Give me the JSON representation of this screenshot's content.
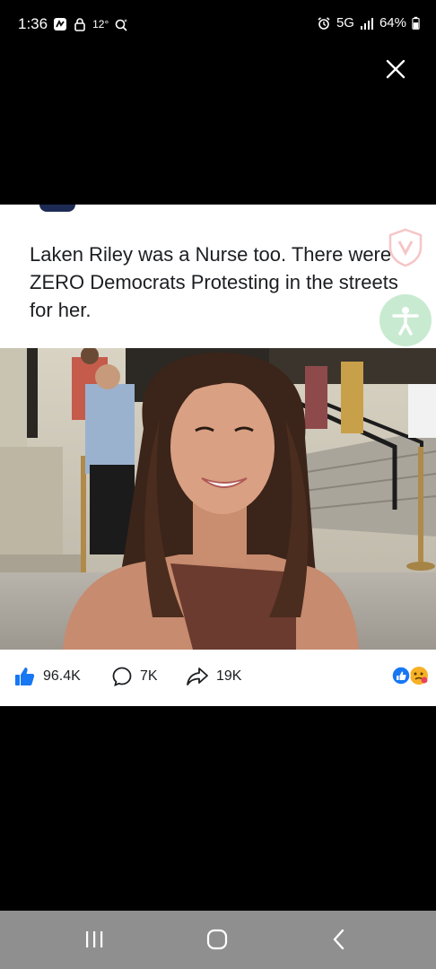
{
  "status_bar": {
    "time": "1:36",
    "temperature": "12°",
    "network": "5G",
    "battery": "64%"
  },
  "post": {
    "text": "Laken Riley was a Nurse too. There were ZERO Democrats Protesting in the streets for her.",
    "stats": {
      "likes": "96.4K",
      "comments": "7K",
      "shares": "19K"
    }
  },
  "colors": {
    "like_blue": "#1877f2",
    "accessibility_green": "#c8ead1",
    "nav_gray": "#8f8f8f"
  },
  "icons": [
    "close-icon",
    "like-icon",
    "comment-icon",
    "share-icon",
    "reaction-summary-icon",
    "accessibility-icon",
    "recent-apps-icon",
    "home-icon",
    "back-icon"
  ]
}
